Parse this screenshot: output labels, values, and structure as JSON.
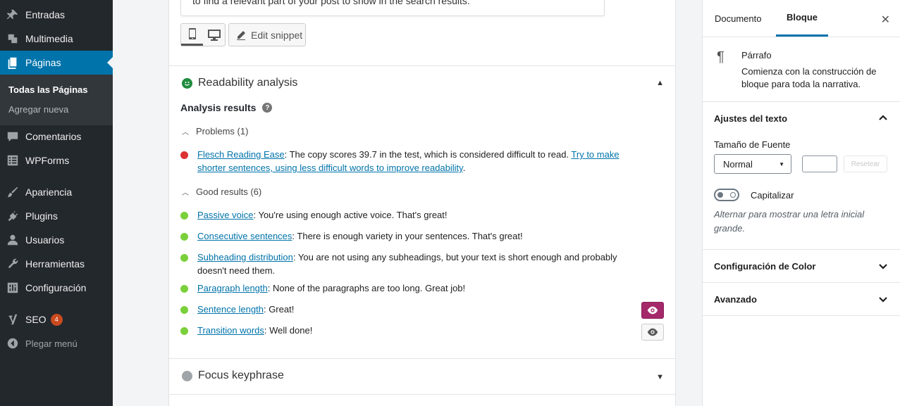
{
  "sidebar": {
    "items": [
      {
        "label": "Entradas",
        "icon": "pin-icon"
      },
      {
        "label": "Multimedia",
        "icon": "media-icon"
      },
      {
        "label": "Páginas",
        "icon": "pages-icon"
      },
      {
        "label": "Comentarios",
        "icon": "comments-icon"
      },
      {
        "label": "WPForms",
        "icon": "forms-icon"
      },
      {
        "label": "Apariencia",
        "icon": "brush-icon"
      },
      {
        "label": "Plugins",
        "icon": "plugin-icon"
      },
      {
        "label": "Usuarios",
        "icon": "users-icon"
      },
      {
        "label": "Herramientas",
        "icon": "wrench-icon"
      },
      {
        "label": "Configuración",
        "icon": "settings-icon"
      },
      {
        "label": "SEO",
        "icon": "yoast-icon",
        "badge": "4"
      }
    ],
    "submenu": [
      "Todas las Páginas",
      "Agregar nueva"
    ],
    "collapse_label": "Plegar menú",
    "accent_color": "#0073aa"
  },
  "snippet": {
    "description_fragment": "to find a relevant part of your post to show in the search results.",
    "edit_label": "Edit snippet"
  },
  "readability": {
    "title": "Readability analysis",
    "status_color": "#1e8c3e",
    "analysis_heading": "Analysis results",
    "problems_label": "Problems (1)",
    "problems": [
      {
        "link": "Flesch Reading Ease",
        "text": ": The copy scores 39.7 in the test, which is considered difficult to read. ",
        "link2": "Try to make shorter sentences, using less difficult words to improve readability",
        "tail": ".",
        "color": "#dc3232"
      }
    ],
    "good_label": "Good results (6)",
    "good": [
      {
        "link": "Passive voice",
        "text": ": You're using enough active voice. That's great!"
      },
      {
        "link": "Consecutive sentences",
        "text": ": There is enough variety in your sentences. That's great!"
      },
      {
        "link": "Subheading distribution",
        "text": ": You are not using any subheadings, but your text is short enough and probably doesn't need them."
      },
      {
        "link": "Paragraph length",
        "text": ": None of the paragraphs are too long. Great job!"
      },
      {
        "link": "Sentence length",
        "text": ": Great!"
      },
      {
        "link": "Transition words",
        "text": ": Well done!"
      }
    ],
    "good_color": "#7ad03a",
    "eye_active_color": "#a4286a"
  },
  "focus": {
    "title": "Focus keyphrase",
    "status_color": "#a0a5aa"
  },
  "inspector": {
    "tabs": [
      "Documento",
      "Bloque"
    ],
    "block_name": "Párrafo",
    "block_description": "Comienza con la construcción de bloque para toda la narrativa.",
    "text_settings_title": "Ajustes del texto",
    "font_size_label": "Tamaño de Fuente",
    "font_size_value": "Normal",
    "reset_label": "Resetear",
    "dropcap_label": "Capitalizar",
    "dropcap_help": "Alternar para mostrar una letra inicial grande.",
    "color_title": "Configuración de Color",
    "advanced_title": "Avanzado"
  }
}
